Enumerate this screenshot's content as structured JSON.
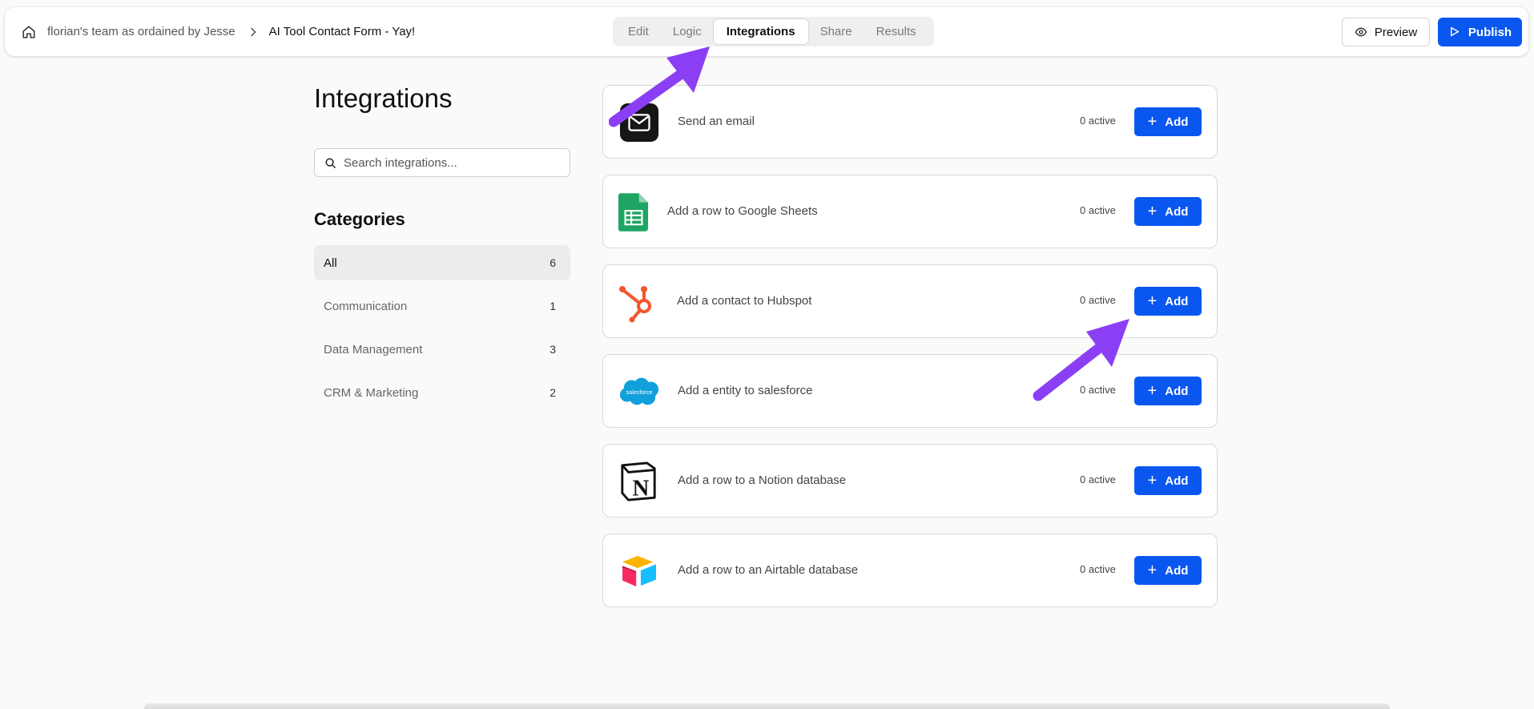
{
  "breadcrumb": {
    "team": "florian's team as ordained by Jesse",
    "form": "AI Tool Contact Form - Yay!"
  },
  "tabs": [
    {
      "label": "Edit",
      "active": false
    },
    {
      "label": "Logic",
      "active": false
    },
    {
      "label": "Integrations",
      "active": true
    },
    {
      "label": "Share",
      "active": false
    },
    {
      "label": "Results",
      "active": false
    }
  ],
  "header_actions": {
    "preview_label": "Preview",
    "publish_label": "Publish"
  },
  "page": {
    "title": "Integrations",
    "search_placeholder": "Search integrations...",
    "categories_title": "Categories"
  },
  "categories": [
    {
      "label": "All",
      "count": "6",
      "active": true
    },
    {
      "label": "Communication",
      "count": "1",
      "active": false
    },
    {
      "label": "Data Management",
      "count": "3",
      "active": false
    },
    {
      "label": "CRM & Marketing",
      "count": "2",
      "active": false
    }
  ],
  "integrations": [
    {
      "label": "Send an email",
      "active": "0 active",
      "button": "Add",
      "icon": "email-icon"
    },
    {
      "label": "Add a row to Google Sheets",
      "active": "0 active",
      "button": "Add",
      "icon": "google-sheets-icon"
    },
    {
      "label": "Add a contact to Hubspot",
      "active": "0 active",
      "button": "Add",
      "icon": "hubspot-icon"
    },
    {
      "label": "Add a entity to salesforce",
      "active": "0 active",
      "button": "Add",
      "icon": "salesforce-icon",
      "logo_text": "salesforce"
    },
    {
      "label": "Add a row to a Notion database",
      "active": "0 active",
      "button": "Add",
      "icon": "notion-icon",
      "logo_text": "N"
    },
    {
      "label": "Add a row to an Airtable database",
      "active": "0 active",
      "button": "Add",
      "icon": "airtable-icon"
    }
  ],
  "colors": {
    "primary": "#0a57f0",
    "annotation_arrow": "#8b3ff5"
  }
}
